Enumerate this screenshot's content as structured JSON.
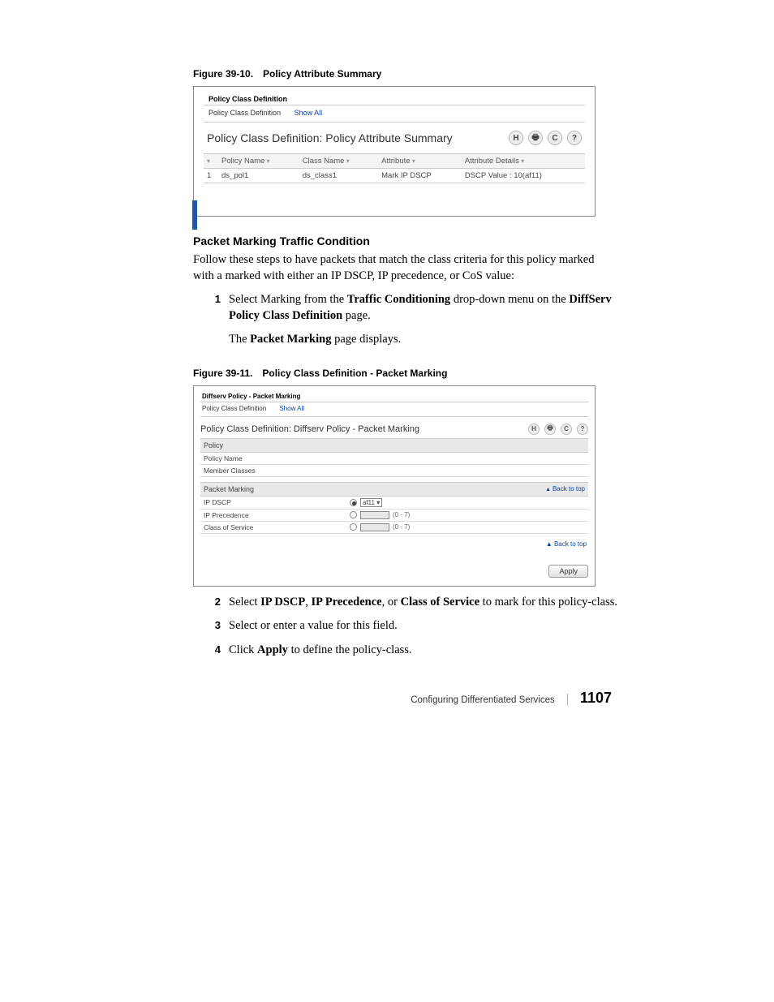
{
  "fig1": {
    "num": "Figure 39-10.",
    "caption": "Policy Attribute Summary",
    "breadcrumb": "Policy Class Definition",
    "tabs": {
      "left": "Policy Class Definition",
      "right": "Show All"
    },
    "title": "Policy Class Definition: Policy Attribute Summary",
    "cols": {
      "idx": "",
      "pol": "Policy Name",
      "cls": "Class Name",
      "attr": "Attribute",
      "det": "Attribute Details"
    },
    "row": {
      "idx": "1",
      "pol": "ds_pol1",
      "cls": "ds_class1",
      "attr": "Mark IP DSCP",
      "det": "DSCP Value : 10(af11)"
    }
  },
  "icons": {
    "save": "H",
    "print": "🖶",
    "refresh": "C",
    "help": "?"
  },
  "sec1_head": "Packet Marking Traffic Condition",
  "para1": "Follow these steps to have packets that match the class criteria for this policy marked with a marked with either an IP DSCP, IP precedence, or CoS value:",
  "step1": {
    "n": "1",
    "pre": "Select Marking from the ",
    "b1": "Traffic Conditioning",
    "mid": " drop-down menu on the ",
    "b2": "DiffServ Policy Class Definition",
    "post": " page."
  },
  "step1b": {
    "pre": "The ",
    "b": "Packet Marking",
    "post": " page displays."
  },
  "fig2": {
    "num": "Figure 39-11.",
    "caption": "Policy Class Definition - Packet Marking",
    "breadcrumb": "Diffserv Policy - Packet Marking",
    "tabs": {
      "left": "Policy Class Definition",
      "right": "Show All"
    },
    "title": "Policy Class Definition: Diffserv Policy - Packet Marking",
    "sec_policy": "Policy",
    "row_pname": "Policy Name",
    "row_mclasses": "Member Classes",
    "sec_pm": "Packet Marking",
    "backtotop": "Back to top",
    "row_dscp": "IP DSCP",
    "dscp_val": "af11",
    "row_prec": "IP Precedence",
    "row_cos": "Class of Service",
    "range": "(0 - 7)",
    "apply": "Apply"
  },
  "step2": {
    "n": "2",
    "pre": "Select ",
    "b1": "IP DSCP",
    "s1": ", ",
    "b2": "IP Precedence",
    "s2": ", or ",
    "b3": "Class of Service",
    "post": " to mark for this policy-class."
  },
  "step3": {
    "n": "3",
    "t": "Select or enter a value for this field."
  },
  "step4": {
    "n": "4",
    "pre": "Click ",
    "b": "Apply",
    "post": " to define the policy-class."
  },
  "footer": {
    "title": "Configuring Differentiated Services",
    "page": "1107"
  }
}
